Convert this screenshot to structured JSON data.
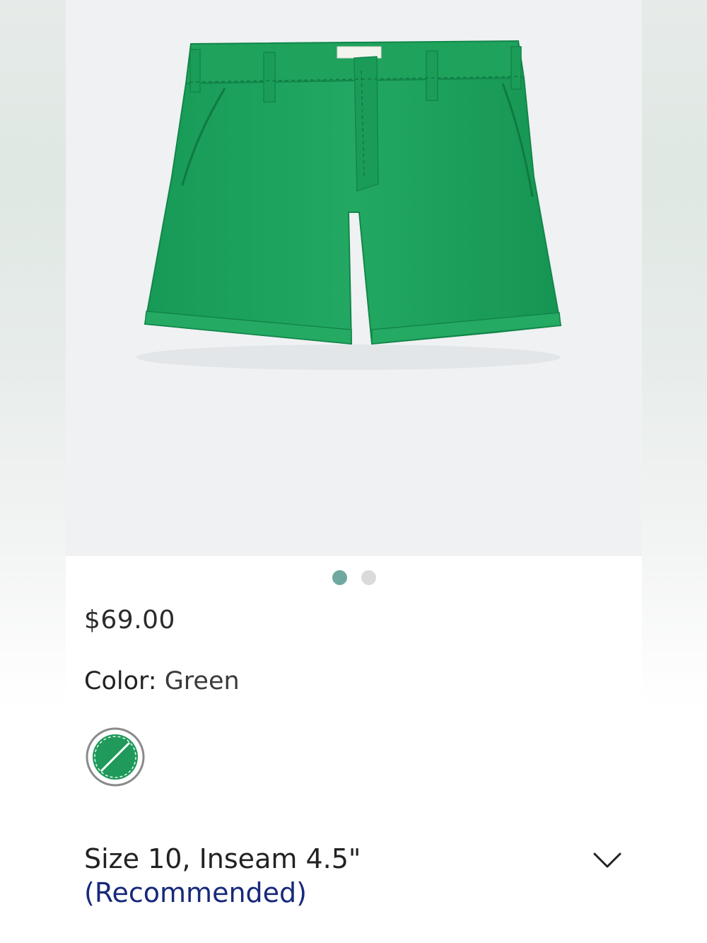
{
  "product": {
    "image_alt": "Green shorts",
    "price": "$69.00",
    "color_label": "Color:",
    "color_value": " Green",
    "swatch_color": "#1f9a5b"
  },
  "carousel": {
    "count": 2,
    "active_index": 0,
    "active_color": "#6fa89f",
    "inactive_color": "#d8dadc"
  },
  "size": {
    "selected": "Size 10, Inseam 4.5\"",
    "recommended": "(Recommended)"
  },
  "icons": {
    "dropdown": "chevron-down-icon",
    "swatch": "color-swatch-icon"
  }
}
